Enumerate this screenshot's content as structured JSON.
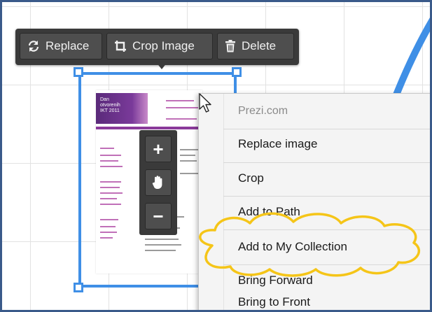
{
  "toolbar": {
    "replace_label": "Replace",
    "crop_label": "Crop Image",
    "delete_label": "Delete"
  },
  "document_thumbnail": {
    "header_lines": [
      "Dan",
      "otvorenih",
      "IKT 2011"
    ]
  },
  "zoom_controls": {
    "plus_symbol": "+",
    "minus_symbol": "−"
  },
  "context_menu": {
    "header": "Prezi.com",
    "items": [
      {
        "label": "Replace image"
      },
      {
        "label": "Crop"
      },
      {
        "label": "Add to Path"
      },
      {
        "label": "Add to My Collection",
        "highlighted": true
      },
      {
        "label": "Bring Forward"
      },
      {
        "label": "Bring to Front"
      }
    ]
  },
  "colors": {
    "selection": "#3f8fe6",
    "toolbar_bg": "#3a3a3a",
    "highlight_cloud": "#f5c518",
    "frame_border": "#3a5a8a"
  }
}
